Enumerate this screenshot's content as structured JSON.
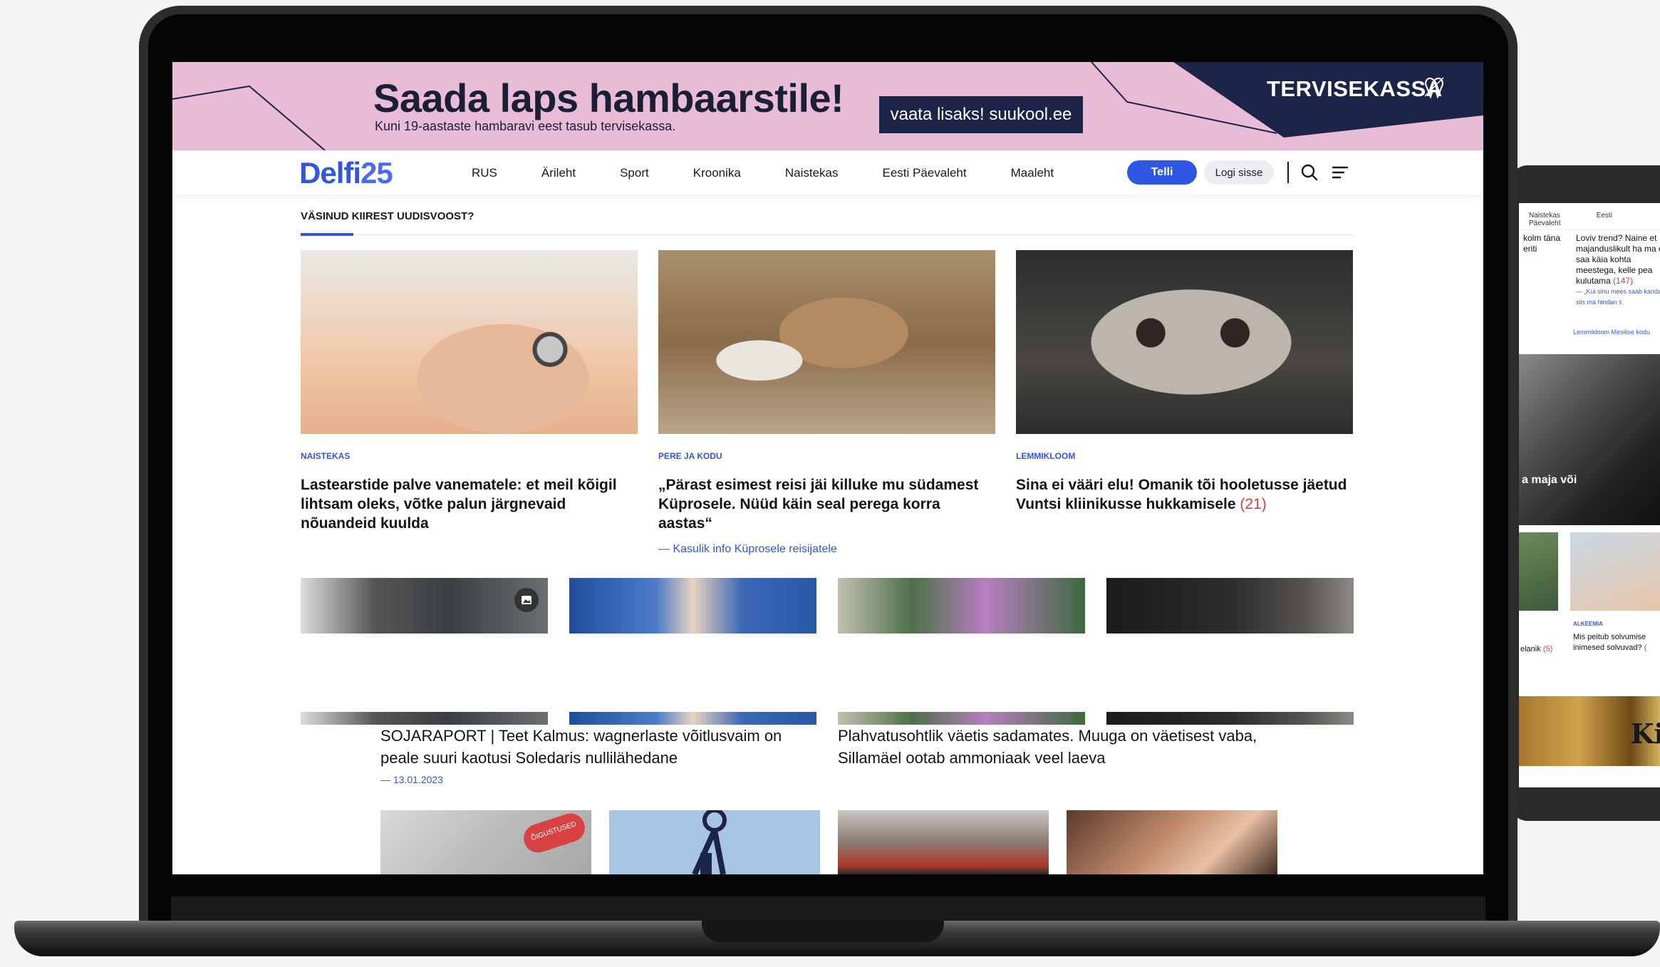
{
  "laptop2": {
    "nav": [
      "Naistekas",
      "Eesti Päevaleht"
    ],
    "left_text": "kolm\ntäna eriti",
    "right_text": "Loviv trend? Naine et majanduslikult ha ma ei saa käia kohta meestega, kelle pea kulutama",
    "right_count": "(147)",
    "related": "— „Kui sinu mees saab kanda, siis ma hindan s",
    "tags": "Lemmikloom   Mesilise kodu",
    "overlay_text": "a maja või",
    "cap1": "elanik",
    "cap1_count": "(5)",
    "category": "ALKEEMIA",
    "cap2": "Mis peitub solvumise inimesed solvuvad?",
    "cap2_count": "(",
    "movie_text": "Ki"
  },
  "banner": {
    "title": "Saada laps hambaarstile!",
    "subtitle": "Kuni 19-aastaste hambaravi eest tasub tervisekassa.",
    "cta": "vaata lisaks! suukool.ee",
    "brand": "TERVISEKASSA",
    "bg_color": "#e8bbd6",
    "brand_color": "#1c2547"
  },
  "nav": {
    "logo_text": "Delfi",
    "logo_num": "25",
    "items": [
      "RUS",
      "Ärileht",
      "Sport",
      "Kroonika",
      "Naistekas",
      "Eesti Päevaleht",
      "Maaleht"
    ],
    "subscribe": "Telli",
    "login": "Logi sisse",
    "accent": "#2f56e4"
  },
  "section": {
    "label": "VÄSINUD KIIREST UUDISVOOST?"
  },
  "articles": [
    {
      "category": "NAISTEKAS",
      "title": "Lastearstide palve vanematele: et meil kõigil lihtsam oleks, võtke palun järgnevaid nõuandeid kuulda"
    },
    {
      "category": "PERE JA KODU",
      "title": "„Pärast esimest reisi jäi killuke mu südamest Küprosele. Nüüd käin seal perega korra aastas“",
      "related": "Kasulik info Küprosele reisijatele"
    },
    {
      "category": "LEMMIKLOOM",
      "title": "Sina ei vääri elu! Omanik tõi hooletusse jäetud Vuntsi kliinikusse hukkamisele",
      "comments": "(21)"
    }
  ],
  "headlines": [
    {
      "title": "SOJARAPORT | Teet Kalmus: wagnerlaste võitlusvaim on peale suuri kaotusi Soledaris nullilähedane",
      "date": "— 13.01.2023"
    },
    {
      "title": "Plahvatusohtlik väetis sadamates. Muuga on väetisest vaba, Sillamäel ootab ammoniaak veel laeva"
    }
  ],
  "bottom_tag": "ÕIGUSTUSED"
}
